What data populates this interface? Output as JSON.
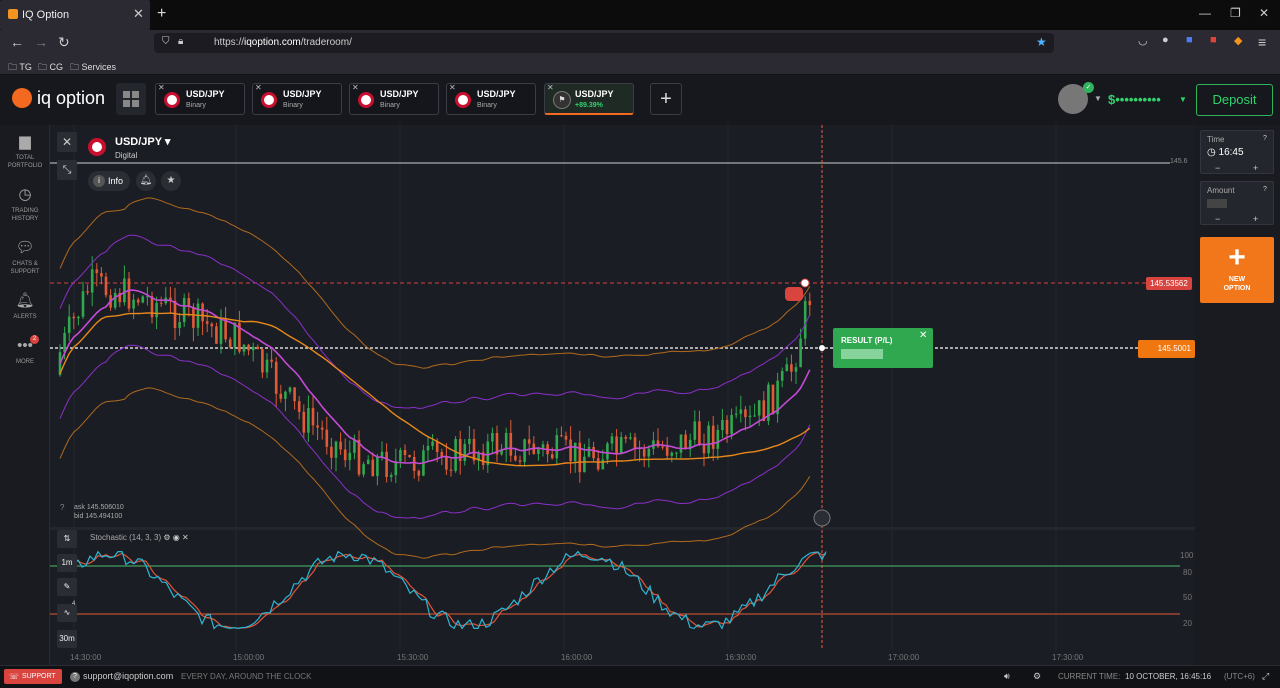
{
  "browser": {
    "tab_title": "IQ Option",
    "url_prefix": "https://",
    "url_host": "iqoption.com",
    "url_path": "/traderoom/",
    "bookmarks": [
      "TG",
      "CG",
      "Services"
    ]
  },
  "header": {
    "logo_text": "iq option",
    "tabs": [
      {
        "name": "USD/JPY",
        "sub": "Binary"
      },
      {
        "name": "USD/JPY",
        "sub": "Binary"
      },
      {
        "name": "USD/JPY",
        "sub": "Binary"
      },
      {
        "name": "USD/JPY",
        "sub": "Binary"
      },
      {
        "name": "USD/JPY",
        "sub": "+89.39%"
      }
    ],
    "balance": "$••••••••••",
    "deposit_label": "Deposit"
  },
  "sidebar": {
    "items": [
      {
        "label": "TOTAL PORTFOLIO",
        "icon": "briefcase-icon"
      },
      {
        "label": "TRADING HISTORY",
        "icon": "history-icon"
      },
      {
        "label": "CHATS & SUPPORT",
        "icon": "chat-icon"
      },
      {
        "label": "ALERTS",
        "icon": "bell-icon"
      },
      {
        "label": "MORE",
        "icon": "more-icon",
        "badge": "2"
      }
    ]
  },
  "chart_header": {
    "asset": "USD/JPY",
    "type": "Digital",
    "info_label": "Info"
  },
  "prices": {
    "top_line": "145.6",
    "strike": "145.53562",
    "current": "145.5001",
    "ask": "ask 145.506010",
    "bid": "bid 145.494100"
  },
  "result": {
    "label": "RESULT (P/L)"
  },
  "indicator": {
    "name": "Stochastic (14, 3, 3)",
    "levels": [
      "100",
      "80",
      "50",
      "20"
    ]
  },
  "timeframes": [
    "1m",
    "30m"
  ],
  "tool_badge": "4",
  "time_axis": [
    "14:30:00",
    "15:00:00",
    "15:30:00",
    "16:00:00",
    "16:30:00",
    "17:00:00",
    "17:30:00"
  ],
  "panel": {
    "time_label": "Time",
    "time_value": "16:45",
    "amount_label": "Amount",
    "minus": "−",
    "plus": "+",
    "new_option": "NEW OPTION"
  },
  "footer": {
    "support": "SUPPORT",
    "email": "support@iqoption.com",
    "hours": "EVERY DAY, AROUND THE CLOCK",
    "current_time_label": "CURRENT TIME:",
    "current_time_value": "10 OCTOBER, 16:45:16",
    "tz": "(UTC+6)"
  },
  "colors": {
    "brand": "#f2691f",
    "up": "#2fa84f",
    "down": "#e05a36",
    "bollinger_outer": "#b06a1c",
    "bollinger_inner": "#8a2fc9",
    "ma": "#c54bd6",
    "stoch_k": "#29b7d4",
    "stoch_d": "#e0543a"
  }
}
